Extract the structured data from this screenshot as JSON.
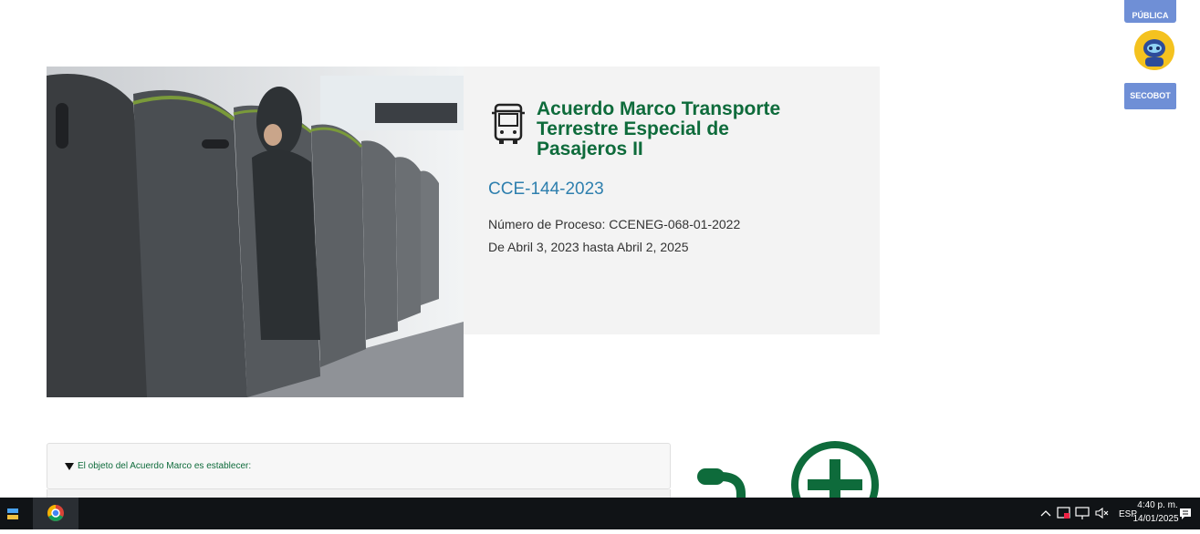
{
  "widgets": {
    "top_label": "PÚBLICA",
    "bot_label": "SECOBOT"
  },
  "hero": {
    "title_line1": "Acuerdo Marco Transporte",
    "title_line2": "Terrestre Especial de",
    "title_line3": "Pasajeros II",
    "code": "CCE-144-2023",
    "process_number": "Número de Proceso: CCENEG-068-01-2022",
    "dates": "De Abril 3, 2023 hasta Abril 2, 2025"
  },
  "accordion": {
    "label": "El objeto del Acuerdo Marco es establecer:"
  },
  "taskbar": {
    "language": "ESP",
    "time": "4:40 p. m.",
    "date": "14/01/2025"
  },
  "colors": {
    "brand_green": "#0e6b3b",
    "code_blue": "#2e7fae",
    "widget_blue": "#6f8fd6"
  },
  "icons": {
    "title_icon": "bus-icon",
    "assistant_icon": "robot-icon"
  }
}
